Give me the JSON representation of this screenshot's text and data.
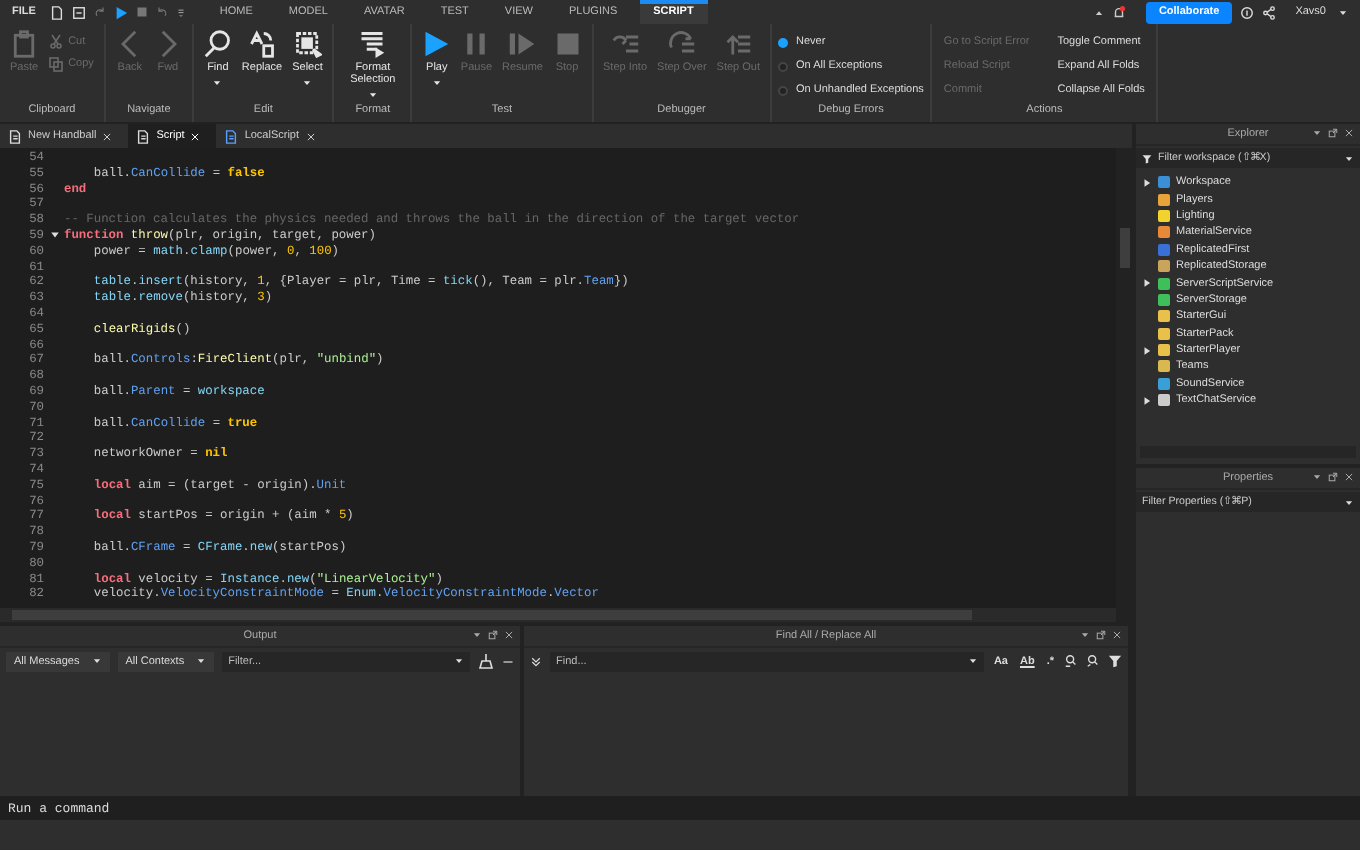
{
  "menubar": {
    "file": "FILE",
    "tabs": [
      {
        "label": "HOME",
        "selected": false
      },
      {
        "label": "MODEL",
        "selected": false
      },
      {
        "label": "AVATAR",
        "selected": false
      },
      {
        "label": "TEST",
        "selected": false
      },
      {
        "label": "VIEW",
        "selected": false
      },
      {
        "label": "PLUGINS",
        "selected": false
      },
      {
        "label": "SCRIPT",
        "selected": true
      }
    ],
    "collaborate": "Collaborate",
    "user": "Xavs0"
  },
  "ribbon": {
    "groups": [
      {
        "label": "Clipboard",
        "tools": [
          {
            "kind": "large",
            "label": "Paste",
            "disabled": true,
            "menu": false
          },
          {
            "kind": "small",
            "label": "Cut",
            "disabled": true
          },
          {
            "kind": "small",
            "label": "Copy",
            "disabled": true
          }
        ]
      },
      {
        "label": "Navigate",
        "tools": [
          {
            "kind": "large",
            "label": "Back",
            "disabled": true,
            "menu": false
          },
          {
            "kind": "large",
            "label": "Fwd",
            "disabled": true,
            "menu": false
          }
        ]
      },
      {
        "label": "Edit",
        "tools": [
          {
            "kind": "large",
            "label": "Find",
            "disabled": false,
            "menu": true
          },
          {
            "kind": "large",
            "label": "Replace",
            "disabled": false,
            "menu": false
          },
          {
            "kind": "large",
            "label": "Select",
            "disabled": false,
            "menu": true
          }
        ]
      },
      {
        "label": "Format",
        "tools": [
          {
            "kind": "large",
            "label": "Format Selection",
            "disabled": false,
            "menu": true
          }
        ]
      },
      {
        "label": "Test",
        "tools": [
          {
            "kind": "large",
            "label": "Play",
            "disabled": false,
            "menu": true
          },
          {
            "kind": "large",
            "label": "Pause",
            "disabled": true,
            "menu": false
          },
          {
            "kind": "large",
            "label": "Resume",
            "disabled": true,
            "menu": false
          },
          {
            "kind": "large",
            "label": "Stop",
            "disabled": true,
            "menu": false
          }
        ]
      },
      {
        "label": "Debugger",
        "tools": [
          {
            "kind": "large",
            "label": "Step Into",
            "disabled": true,
            "menu": false
          },
          {
            "kind": "large",
            "label": "Step Over",
            "disabled": true,
            "menu": false
          },
          {
            "kind": "large",
            "label": "Step Out",
            "disabled": true,
            "menu": false
          }
        ]
      },
      {
        "label": "Debug Errors",
        "tools": [
          {
            "kind": "radio",
            "label": "Never",
            "selected": true
          },
          {
            "kind": "radio",
            "label": "On All Exceptions",
            "selected": false
          },
          {
            "kind": "radio",
            "label": "On Unhandled Exceptions",
            "selected": false
          }
        ]
      },
      {
        "label": "Actions",
        "tools": [
          {
            "kind": "action",
            "label": "Go to Script Error",
            "disabled": true
          },
          {
            "kind": "action",
            "label": "Reload Script",
            "disabled": true
          },
          {
            "kind": "action",
            "label": "Commit",
            "disabled": true
          },
          {
            "kind": "action",
            "label": "Toggle Comment",
            "disabled": false
          },
          {
            "kind": "action",
            "label": "Expand All Folds",
            "disabled": false
          },
          {
            "kind": "action",
            "label": "Collapse All Folds",
            "disabled": false
          }
        ]
      }
    ]
  },
  "doc_tabs": [
    {
      "label": "New Handball",
      "selected": false
    },
    {
      "label": "Script",
      "selected": true
    },
    {
      "label": "LocalScript",
      "selected": false
    }
  ],
  "editor": {
    "lines": [
      {
        "number": "54",
        "fold": false
      },
      {
        "number": "55",
        "fold": false,
        "indented": true,
        "tokens": [
          {
            "kind": "plain",
            "text": "ball."
          },
          {
            "kind": "property",
            "text": "CanCollide"
          },
          {
            "kind": "plain",
            "text": " = "
          },
          {
            "kind": "constant",
            "text": "false"
          }
        ]
      },
      {
        "number": "56",
        "fold": false,
        "indented": false,
        "tokens": [
          {
            "kind": "keyword",
            "text": "end"
          }
        ]
      },
      {
        "number": "57",
        "fold": false
      },
      {
        "number": "58",
        "fold": false,
        "indented": false,
        "tokens": [
          {
            "kind": "comment",
            "text": "-- Function calculates the physics needed and throws the ball in the direction of the target vector"
          }
        ]
      },
      {
        "number": "59",
        "fold": true,
        "indented": false,
        "tokens": [
          {
            "kind": "keyword",
            "text": "function"
          },
          {
            "kind": "function",
            "text": " throw"
          },
          {
            "kind": "plain",
            "text": "(plr, origin, target, power)"
          }
        ]
      },
      {
        "number": "60",
        "fold": false,
        "indented": true,
        "tokens": [
          {
            "kind": "plain",
            "text": "power = "
          },
          {
            "kind": "builtin",
            "text": "math"
          },
          {
            "kind": "plain",
            "text": "."
          },
          {
            "kind": "builtin",
            "text": "clamp"
          },
          {
            "kind": "plain",
            "text": "(power, "
          },
          {
            "kind": "number",
            "text": "0"
          },
          {
            "kind": "plain",
            "text": ", "
          },
          {
            "kind": "number",
            "text": "100"
          },
          {
            "kind": "plain",
            "text": ")"
          }
        ]
      },
      {
        "number": "61",
        "fold": false
      },
      {
        "number": "62",
        "fold": false,
        "indented": true,
        "tokens": [
          {
            "kind": "builtin",
            "text": "table"
          },
          {
            "kind": "plain",
            "text": "."
          },
          {
            "kind": "builtin",
            "text": "insert"
          },
          {
            "kind": "plain",
            "text": "(history, "
          },
          {
            "kind": "number",
            "text": "1"
          },
          {
            "kind": "plain",
            "text": ", {Player = plr, Time = "
          },
          {
            "kind": "builtin",
            "text": "tick"
          },
          {
            "kind": "plain",
            "text": "(), Team = plr."
          },
          {
            "kind": "property",
            "text": "Team"
          },
          {
            "kind": "plain",
            "text": "})"
          }
        ]
      },
      {
        "number": "63",
        "fold": false,
        "indented": true,
        "tokens": [
          {
            "kind": "builtin",
            "text": "table"
          },
          {
            "kind": "plain",
            "text": "."
          },
          {
            "kind": "builtin",
            "text": "remove"
          },
          {
            "kind": "plain",
            "text": "(history, "
          },
          {
            "kind": "number",
            "text": "3"
          },
          {
            "kind": "plain",
            "text": ")"
          }
        ]
      },
      {
        "number": "64",
        "fold": false
      },
      {
        "number": "65",
        "fold": false,
        "indented": true,
        "tokens": [
          {
            "kind": "function",
            "text": "clearRigids"
          },
          {
            "kind": "plain",
            "text": "()"
          }
        ]
      },
      {
        "number": "66",
        "fold": false
      },
      {
        "number": "67",
        "fold": false,
        "indented": true,
        "tokens": [
          {
            "kind": "plain",
            "text": "ball."
          },
          {
            "kind": "property",
            "text": "Controls"
          },
          {
            "kind": "plain",
            "text": ":"
          },
          {
            "kind": "function",
            "text": "FireClient"
          },
          {
            "kind": "plain",
            "text": "(plr, "
          },
          {
            "kind": "string",
            "text": "\"unbind\""
          },
          {
            "kind": "plain",
            "text": ")"
          }
        ]
      },
      {
        "number": "68",
        "fold": false
      },
      {
        "number": "69",
        "fold": false,
        "indented": true,
        "tokens": [
          {
            "kind": "plain",
            "text": "ball."
          },
          {
            "kind": "property",
            "text": "Parent"
          },
          {
            "kind": "plain",
            "text": " = "
          },
          {
            "kind": "builtin",
            "text": "workspace"
          }
        ]
      },
      {
        "number": "70",
        "fold": false
      },
      {
        "number": "71",
        "fold": false,
        "indented": true,
        "tokens": [
          {
            "kind": "plain",
            "text": "ball."
          },
          {
            "kind": "property",
            "text": "CanCollide"
          },
          {
            "kind": "plain",
            "text": " = "
          },
          {
            "kind": "constant",
            "text": "true"
          }
        ]
      },
      {
        "number": "72",
        "fold": false
      },
      {
        "number": "73",
        "fold": false,
        "indented": true,
        "tokens": [
          {
            "kind": "plain",
            "text": "networkOwner = "
          },
          {
            "kind": "constant",
            "text": "nil"
          }
        ]
      },
      {
        "number": "74",
        "fold": false
      },
      {
        "number": "75",
        "fold": false,
        "indented": true,
        "tokens": [
          {
            "kind": "keyword",
            "text": "local"
          },
          {
            "kind": "plain",
            "text": " aim = (target - origin)."
          },
          {
            "kind": "property",
            "text": "Unit"
          }
        ]
      },
      {
        "number": "76",
        "fold": false
      },
      {
        "number": "77",
        "fold": false,
        "indented": true,
        "tokens": [
          {
            "kind": "keyword",
            "text": "local"
          },
          {
            "kind": "plain",
            "text": " startPos = origin + (aim * "
          },
          {
            "kind": "number",
            "text": "5"
          },
          {
            "kind": "plain",
            "text": ")"
          }
        ]
      },
      {
        "number": "78",
        "fold": false
      },
      {
        "number": "79",
        "fold": false,
        "indented": true,
        "tokens": [
          {
            "kind": "plain",
            "text": "ball."
          },
          {
            "kind": "property",
            "text": "CFrame"
          },
          {
            "kind": "plain",
            "text": " = "
          },
          {
            "kind": "builtin",
            "text": "CFrame"
          },
          {
            "kind": "plain",
            "text": "."
          },
          {
            "kind": "builtin",
            "text": "new"
          },
          {
            "kind": "plain",
            "text": "(startPos)"
          }
        ]
      },
      {
        "number": "80",
        "fold": false
      },
      {
        "number": "81",
        "fold": false,
        "indented": true,
        "tokens": [
          {
            "kind": "keyword",
            "text": "local"
          },
          {
            "kind": "plain",
            "text": " velocity = "
          },
          {
            "kind": "builtin",
            "text": "Instance"
          },
          {
            "kind": "plain",
            "text": "."
          },
          {
            "kind": "builtin",
            "text": "new"
          },
          {
            "kind": "plain",
            "text": "("
          },
          {
            "kind": "string",
            "text": "\"LinearVelocity\""
          },
          {
            "kind": "plain",
            "text": ")"
          }
        ]
      },
      {
        "number": "82",
        "fold": false,
        "indented": true,
        "tokens": [
          {
            "kind": "plain",
            "text": "velocity."
          },
          {
            "kind": "property",
            "text": "VelocityConstraintMode"
          },
          {
            "kind": "plain",
            "text": " = "
          },
          {
            "kind": "builtin",
            "text": "Enum"
          },
          {
            "kind": "plain",
            "text": "."
          },
          {
            "kind": "property",
            "text": "VelocityConstraintMode"
          },
          {
            "kind": "plain",
            "text": "."
          },
          {
            "kind": "property",
            "text": "Vector"
          }
        ]
      }
    ]
  },
  "output": {
    "title": "Output",
    "messages_filter": "All Messages",
    "contexts_filter": "All Contexts",
    "filter": {
      "placeholder": "Filter..."
    }
  },
  "find_all": {
    "title": "Find All / Replace All",
    "find": {
      "placeholder": "Find..."
    },
    "options": [
      "Aa",
      "Ab",
      ".*"
    ]
  },
  "explorer": {
    "title": "Explorer",
    "filter": {
      "placeholder": "Filter workspace (⇧⌘X)"
    },
    "items": [
      {
        "label": "Workspace",
        "expandable": true,
        "color": "#3a8fd6"
      },
      {
        "label": "Players",
        "expandable": false,
        "color": "#e8a33a"
      },
      {
        "label": "Lighting",
        "expandable": false,
        "color": "#f2d22e"
      },
      {
        "label": "MaterialService",
        "expandable": false,
        "color": "#e8893a"
      },
      {
        "label": "ReplicatedFirst",
        "expandable": false,
        "color": "#3a6fd6"
      },
      {
        "label": "ReplicatedStorage",
        "expandable": false,
        "color": "#c9a45a"
      },
      {
        "label": "ServerScriptService",
        "expandable": true,
        "color": "#3fbf5a"
      },
      {
        "label": "ServerStorage",
        "expandable": false,
        "color": "#3fbf5a"
      },
      {
        "label": "StarterGui",
        "expandable": false,
        "color": "#e8c04a"
      },
      {
        "label": "StarterPack",
        "expandable": false,
        "color": "#e8c04a"
      },
      {
        "label": "StarterPlayer",
        "expandable": true,
        "color": "#e8c04a"
      },
      {
        "label": "Teams",
        "expandable": false,
        "color": "#d9b850"
      },
      {
        "label": "SoundService",
        "expandable": false,
        "color": "#3a9fd6"
      },
      {
        "label": "TextChatService",
        "expandable": true,
        "color": "#cccccc"
      }
    ]
  },
  "properties": {
    "title": "Properties",
    "filter": {
      "placeholder": "Filter Properties (⇧⌘P)"
    }
  },
  "command_bar": {
    "placeholder": "Run a command"
  }
}
